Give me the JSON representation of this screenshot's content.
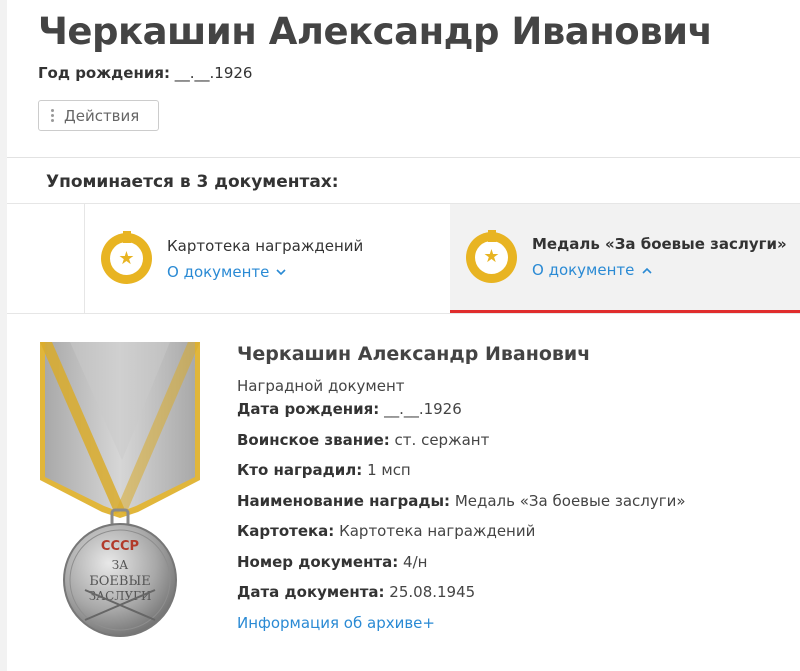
{
  "person": {
    "name": "Черкашин Александр Иванович",
    "birth_label": "Год рождения:",
    "birth_value": "__.__.1926"
  },
  "actions": {
    "label": "Действия"
  },
  "mentions": {
    "label": "Упоминается в 3 документах:"
  },
  "tabs": [
    {
      "title": "Картотека награждений",
      "link": "О документе",
      "chevron": "chevron-down-icon"
    },
    {
      "title": "Медаль «За боевые заслуги»",
      "link": "О документе",
      "chevron": "chevron-up-icon"
    }
  ],
  "document": {
    "name": "Черкашин Александр Иванович",
    "type": "Наградной документ",
    "fields": [
      {
        "label": "Дата рождения:",
        "value": "__.__.1926"
      },
      {
        "label": "Воинское звание:",
        "value": "ст. сержант"
      },
      {
        "label": "Кто наградил:",
        "value": "1 мсп"
      },
      {
        "label": "Наименование награды:",
        "value": "Медаль «За боевые заслуги»"
      },
      {
        "label": "Картотека:",
        "value": "Картотека награждений"
      },
      {
        "label": "Номер документа:",
        "value": "4/н"
      },
      {
        "label": "Дата документа:",
        "value": "25.08.1945"
      }
    ],
    "archive_link": "Информация об архиве+"
  },
  "medal": {
    "top_text": "СССР",
    "middle_text": "ЗА",
    "line2": "БОЕВЫЕ",
    "line3": "ЗАСЛУГИ"
  },
  "colors": {
    "accent_gold": "#e8b422",
    "link_blue": "#2a8ad4",
    "active_tab_underline": "#e02d2d"
  }
}
